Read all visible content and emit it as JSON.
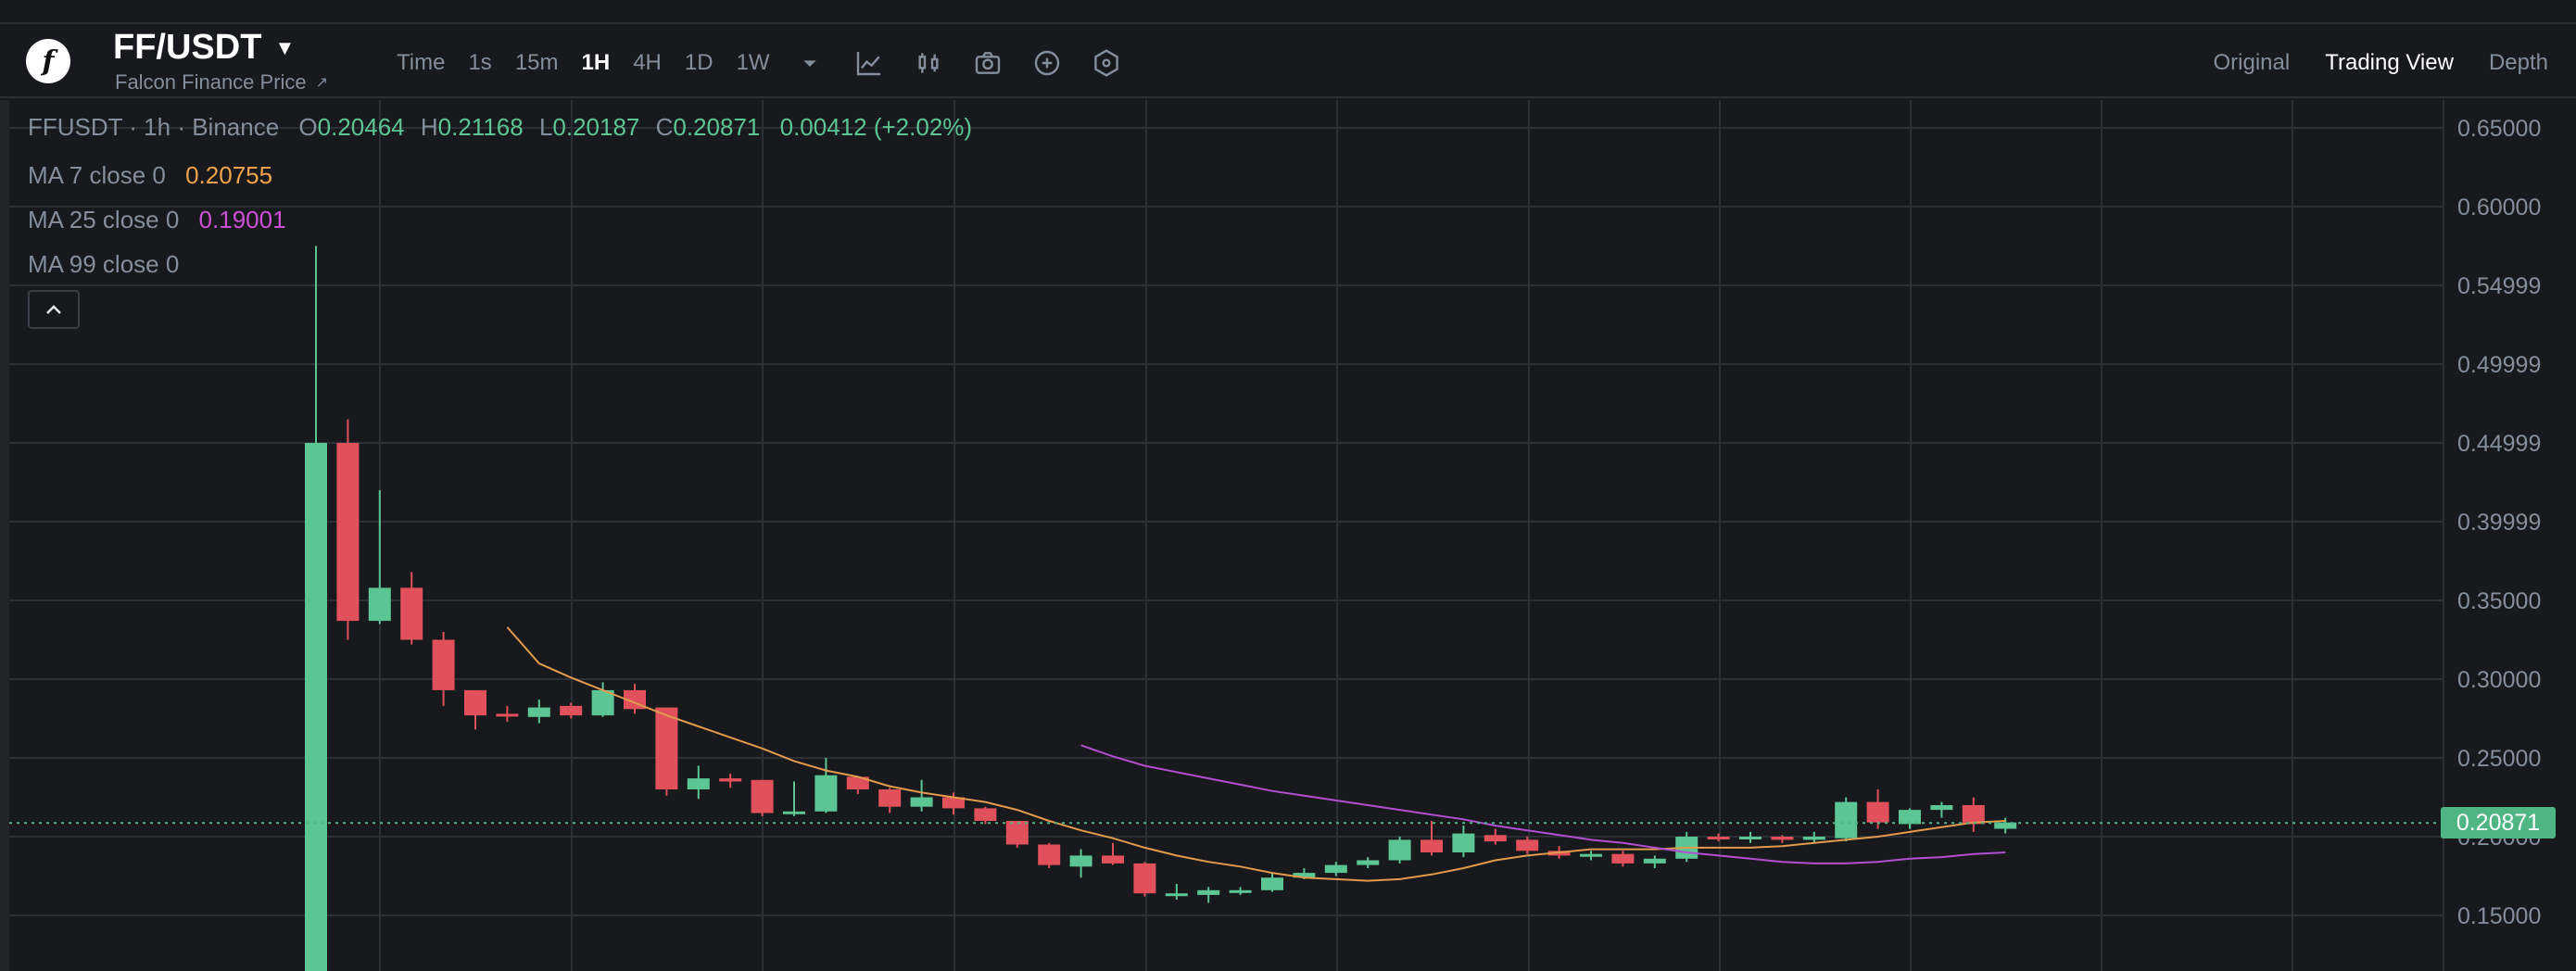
{
  "header": {
    "pair": "FF/USDT",
    "subtitle": "Falcon Finance Price",
    "ext_icon": "external-link-icon",
    "timeframes": [
      "Time",
      "1s",
      "15m",
      "1H",
      "4H",
      "1D",
      "1W"
    ],
    "active_timeframe": "1H",
    "tools": [
      "chevron-down-icon",
      "line-chart-icon",
      "candlestick-icon",
      "camera-icon",
      "plus-circle-icon",
      "settings-hexagon-icon"
    ],
    "views": [
      "Original",
      "Trading View",
      "Depth"
    ],
    "active_view": "Trading View"
  },
  "legend": {
    "symbol": "FFUSDT · 1h · Binance",
    "o_label": "O",
    "o_value": "0.20464",
    "h_label": "H",
    "h_value": "0.21168",
    "l_label": "L",
    "l_value": "0.20187",
    "c_label": "C",
    "c_value": "0.20871",
    "change": "0.00412 (+2.02%)",
    "ma7_label": "MA 7 close 0",
    "ma7_value": "0.20755",
    "ma25_label": "MA 25 close 0",
    "ma25_value": "0.19001",
    "ma99_label": "MA 99 close 0"
  },
  "last_price": "0.20871",
  "colors": {
    "up": "#5cc594",
    "down": "#e0515c",
    "ma7": "#e29a4d",
    "ma25": "#b24fd0",
    "grid": "#2b2f36",
    "price_tag": "#4fb683"
  },
  "chart_data": {
    "type": "candlestick",
    "y_ticks": [
      "0.65000",
      "0.60000",
      "0.54999",
      "0.49999",
      "0.44999",
      "0.39999",
      "0.35000",
      "0.30000",
      "0.25000",
      "0.20000",
      "0.15000"
    ],
    "ylim": [
      0.12,
      0.67
    ],
    "candles": [
      {
        "o": 0.0,
        "h": 0.575,
        "l": 0.0,
        "c": 0.45
      },
      {
        "o": 0.45,
        "h": 0.465,
        "l": 0.325,
        "c": 0.337
      },
      {
        "o": 0.337,
        "h": 0.42,
        "l": 0.335,
        "c": 0.358
      },
      {
        "o": 0.358,
        "h": 0.368,
        "l": 0.322,
        "c": 0.325
      },
      {
        "o": 0.325,
        "h": 0.33,
        "l": 0.283,
        "c": 0.293
      },
      {
        "o": 0.293,
        "h": 0.293,
        "l": 0.268,
        "c": 0.277
      },
      {
        "o": 0.278,
        "h": 0.283,
        "l": 0.273,
        "c": 0.277
      },
      {
        "o": 0.276,
        "h": 0.287,
        "l": 0.272,
        "c": 0.282
      },
      {
        "o": 0.283,
        "h": 0.285,
        "l": 0.275,
        "c": 0.277
      },
      {
        "o": 0.277,
        "h": 0.298,
        "l": 0.276,
        "c": 0.293
      },
      {
        "o": 0.293,
        "h": 0.297,
        "l": 0.278,
        "c": 0.281
      },
      {
        "o": 0.282,
        "h": 0.282,
        "l": 0.226,
        "c": 0.23
      },
      {
        "o": 0.23,
        "h": 0.245,
        "l": 0.224,
        "c": 0.237
      },
      {
        "o": 0.237,
        "h": 0.24,
        "l": 0.231,
        "c": 0.235
      },
      {
        "o": 0.236,
        "h": 0.236,
        "l": 0.213,
        "c": 0.215
      },
      {
        "o": 0.215,
        "h": 0.235,
        "l": 0.213,
        "c": 0.216
      },
      {
        "o": 0.216,
        "h": 0.25,
        "l": 0.215,
        "c": 0.239
      },
      {
        "o": 0.238,
        "h": 0.238,
        "l": 0.227,
        "c": 0.23
      },
      {
        "o": 0.23,
        "h": 0.231,
        "l": 0.215,
        "c": 0.219
      },
      {
        "o": 0.219,
        "h": 0.236,
        "l": 0.216,
        "c": 0.225
      },
      {
        "o": 0.225,
        "h": 0.228,
        "l": 0.214,
        "c": 0.218
      },
      {
        "o": 0.218,
        "h": 0.219,
        "l": 0.208,
        "c": 0.21
      },
      {
        "o": 0.21,
        "h": 0.21,
        "l": 0.193,
        "c": 0.195
      },
      {
        "o": 0.195,
        "h": 0.196,
        "l": 0.18,
        "c": 0.182
      },
      {
        "o": 0.181,
        "h": 0.192,
        "l": 0.174,
        "c": 0.188
      },
      {
        "o": 0.188,
        "h": 0.196,
        "l": 0.182,
        "c": 0.183
      },
      {
        "o": 0.183,
        "h": 0.184,
        "l": 0.162,
        "c": 0.164
      },
      {
        "o": 0.164,
        "h": 0.17,
        "l": 0.16,
        "c": 0.164
      },
      {
        "o": 0.163,
        "h": 0.168,
        "l": 0.158,
        "c": 0.166
      },
      {
        "o": 0.166,
        "h": 0.168,
        "l": 0.163,
        "c": 0.166
      },
      {
        "o": 0.166,
        "h": 0.177,
        "l": 0.165,
        "c": 0.174
      },
      {
        "o": 0.174,
        "h": 0.18,
        "l": 0.173,
        "c": 0.177
      },
      {
        "o": 0.177,
        "h": 0.184,
        "l": 0.175,
        "c": 0.182
      },
      {
        "o": 0.182,
        "h": 0.187,
        "l": 0.18,
        "c": 0.185
      },
      {
        "o": 0.185,
        "h": 0.2,
        "l": 0.183,
        "c": 0.198
      },
      {
        "o": 0.198,
        "h": 0.21,
        "l": 0.188,
        "c": 0.19
      },
      {
        "o": 0.19,
        "h": 0.207,
        "l": 0.187,
        "c": 0.202
      },
      {
        "o": 0.201,
        "h": 0.205,
        "l": 0.195,
        "c": 0.197
      },
      {
        "o": 0.198,
        "h": 0.2,
        "l": 0.189,
        "c": 0.191
      },
      {
        "o": 0.191,
        "h": 0.194,
        "l": 0.186,
        "c": 0.188
      },
      {
        "o": 0.188,
        "h": 0.191,
        "l": 0.185,
        "c": 0.189
      },
      {
        "o": 0.189,
        "h": 0.191,
        "l": 0.181,
        "c": 0.183
      },
      {
        "o": 0.183,
        "h": 0.188,
        "l": 0.18,
        "c": 0.186
      },
      {
        "o": 0.186,
        "h": 0.203,
        "l": 0.184,
        "c": 0.2
      },
      {
        "o": 0.2,
        "h": 0.202,
        "l": 0.197,
        "c": 0.199
      },
      {
        "o": 0.199,
        "h": 0.203,
        "l": 0.196,
        "c": 0.2
      },
      {
        "o": 0.2,
        "h": 0.201,
        "l": 0.196,
        "c": 0.198
      },
      {
        "o": 0.198,
        "h": 0.203,
        "l": 0.196,
        "c": 0.2
      },
      {
        "o": 0.199,
        "h": 0.225,
        "l": 0.197,
        "c": 0.222
      },
      {
        "o": 0.222,
        "h": 0.23,
        "l": 0.205,
        "c": 0.209
      },
      {
        "o": 0.208,
        "h": 0.218,
        "l": 0.205,
        "c": 0.217
      },
      {
        "o": 0.217,
        "h": 0.222,
        "l": 0.212,
        "c": 0.22
      },
      {
        "o": 0.22,
        "h": 0.225,
        "l": 0.203,
        "c": 0.208
      },
      {
        "o": 0.205,
        "h": 0.212,
        "l": 0.202,
        "c": 0.209
      }
    ],
    "ma7": [
      null,
      null,
      null,
      null,
      null,
      null,
      0.333,
      0.31,
      0.301,
      0.293,
      0.285,
      0.277,
      0.27,
      0.263,
      0.256,
      0.248,
      0.242,
      0.238,
      0.232,
      0.228,
      0.225,
      0.222,
      0.217,
      0.21,
      0.204,
      0.199,
      0.193,
      0.188,
      0.184,
      0.181,
      0.177,
      0.174,
      0.173,
      0.172,
      0.173,
      0.176,
      0.18,
      0.185,
      0.188,
      0.19,
      0.192,
      0.192,
      0.192,
      0.193,
      0.193,
      0.193,
      0.194,
      0.196,
      0.198,
      0.2,
      0.203,
      0.206,
      0.209,
      0.21
    ],
    "ma25": [
      null,
      null,
      null,
      null,
      null,
      null,
      null,
      null,
      null,
      null,
      null,
      null,
      null,
      null,
      null,
      null,
      null,
      null,
      null,
      null,
      null,
      null,
      null,
      null,
      0.258,
      0.251,
      0.245,
      0.241,
      0.237,
      0.233,
      0.229,
      0.226,
      0.223,
      0.22,
      0.217,
      0.214,
      0.211,
      0.207,
      0.204,
      0.201,
      0.198,
      0.196,
      0.193,
      0.19,
      0.188,
      0.186,
      0.184,
      0.183,
      0.183,
      0.184,
      0.186,
      0.187,
      0.189,
      0.19
    ]
  }
}
